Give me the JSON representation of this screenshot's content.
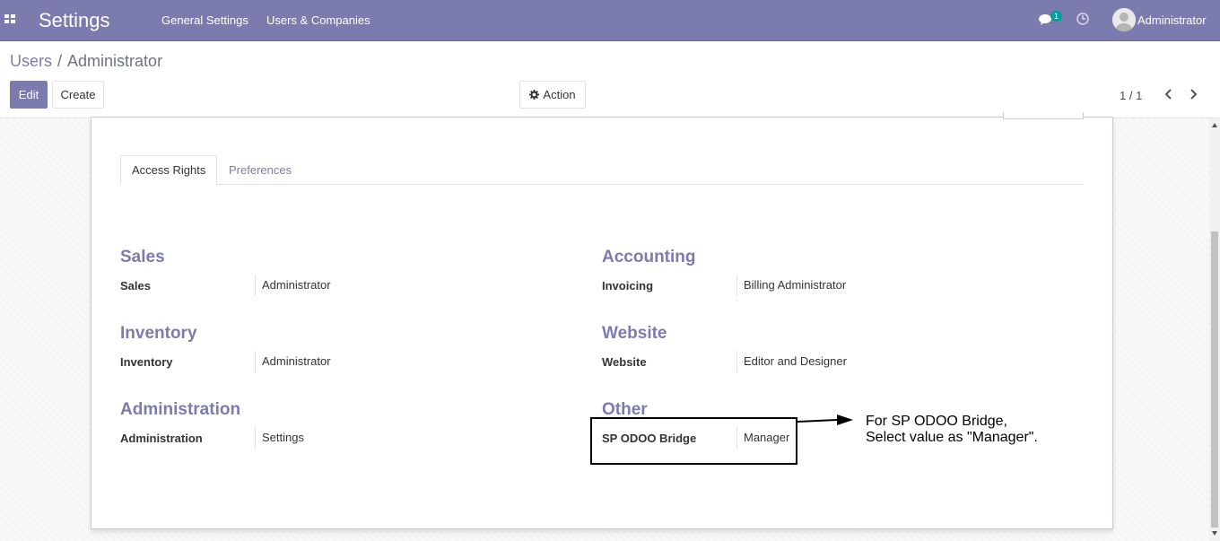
{
  "navbar": {
    "app_title": "Settings",
    "menu": [
      "General Settings",
      "Users & Companies"
    ],
    "chat_count": "1",
    "user_name": "Administrator",
    "bg_color": "#7c7bad"
  },
  "control_panel": {
    "breadcrumb_parent": "Users",
    "breadcrumb_separator": "/",
    "breadcrumb_current": "Administrator",
    "edit_label": "Edit",
    "create_label": "Create",
    "action_label": "Action",
    "pager": "1 / 1"
  },
  "tabs": [
    "Access Rights",
    "Preferences"
  ],
  "groups": {
    "sales": {
      "title": "Sales",
      "label": "Sales",
      "value": "Administrator"
    },
    "inventory": {
      "title": "Inventory",
      "label": "Inventory",
      "value": "Administrator"
    },
    "administration": {
      "title": "Administration",
      "label": "Administration",
      "value": "Settings"
    },
    "accounting": {
      "title": "Accounting",
      "label": "Invoicing",
      "value": "Billing Administrator"
    },
    "website": {
      "title": "Website",
      "label": "Website",
      "value": "Editor and Designer"
    },
    "other": {
      "title": "Other",
      "label": "SP ODOO Bridge",
      "value": "Manager"
    }
  },
  "annotation": {
    "line1": "For SP ODOO Bridge,",
    "line2": "Select value as \"Manager\"."
  },
  "icons": {
    "apps": "apps-grid-icon",
    "chat": "chat-icon",
    "activity": "clock-icon",
    "action": "gear-icon",
    "prev": "chevron-left-icon",
    "next": "chevron-right-icon"
  }
}
